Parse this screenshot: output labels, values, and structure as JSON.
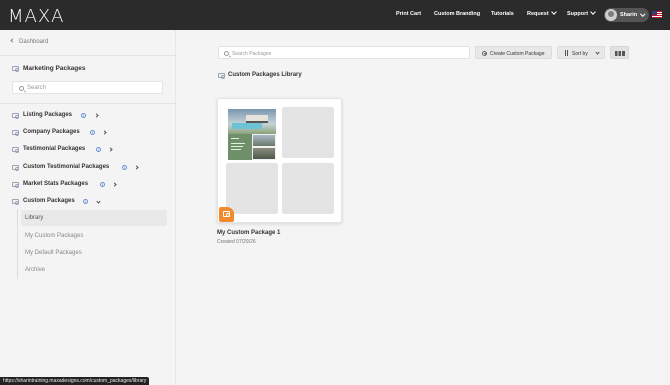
{
  "header": {
    "logo": "MAXA",
    "nav": [
      "Print Cart",
      "Custom Branding",
      "Tutorials",
      "Request",
      "Support"
    ],
    "user_name": "Sharin",
    "language_flag_icon": "us-flag-icon"
  },
  "sidebar": {
    "back_label": "Dashboard",
    "heading": "Marketing Packages",
    "search_placeholder": "Search",
    "categories": [
      {
        "label": "Listing Packages",
        "info": "i"
      },
      {
        "label": "Company Packages",
        "info": "i"
      },
      {
        "label": "Testimonial Packages",
        "info": "i"
      },
      {
        "label": "Custom Testimonial Packages",
        "info": "i"
      },
      {
        "label": "Market Stats Packages",
        "info": "i"
      },
      {
        "label": "Custom Packages",
        "info": "i"
      }
    ],
    "sub_items": [
      "Library",
      "My Custom Packages",
      "My Default Packages",
      "Archive"
    ],
    "active_sub_item": "Library"
  },
  "main": {
    "search_placeholder": "Search Packages",
    "create_button": "Create Custom Package",
    "sort_button": "Sort by",
    "section_title": "Custom Packages Library",
    "package": {
      "title": "My Custom Package 1",
      "created": "Created 07/29/26"
    }
  },
  "status_bar": {
    "url": "https://sharintraining.maxadesigns.com/custom_packages/library"
  },
  "colors": {
    "topbar": "#2b2b2b",
    "accent_orange": "#f08a2c",
    "info_blue": "#6b8fd6"
  }
}
